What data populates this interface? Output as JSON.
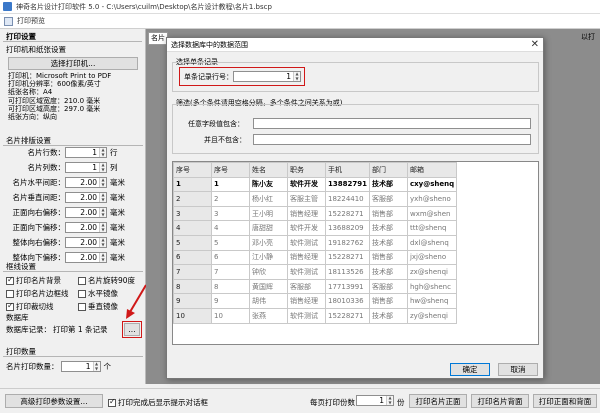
{
  "window": {
    "title": "神奇名片设计打印软件 5.0 - C:\\Users\\cuilm\\Desktop\\名片设计教程\\名片1.bscp"
  },
  "preview_window": {
    "title": "打印预览"
  },
  "left": {
    "print_settings": "打印设置",
    "printer_section": "打印机和纸张设置",
    "choose_printer": "选择打印机...",
    "info": [
      "打印机：Microsoft Print to PDF",
      "打印机分辨率：600像素/英寸",
      "纸张名称：A4",
      "可打印区域宽度：210.0 毫米",
      "可打印区域高度：297.0 毫米",
      "纸张方向：纵向"
    ],
    "layout_section": "名片排版设置",
    "fields": [
      {
        "label": "名片行数：",
        "value": "1",
        "unit": "行"
      },
      {
        "label": "名片列数：",
        "value": "1",
        "unit": "列"
      },
      {
        "label": "名片水平间距：",
        "value": "2.00",
        "unit": "毫米"
      },
      {
        "label": "名片垂直间距：",
        "value": "2.00",
        "unit": "毫米"
      },
      {
        "label": "正面向右偏移：",
        "value": "2.00",
        "unit": "毫米"
      },
      {
        "label": "正面向下偏移：",
        "value": "2.00",
        "unit": "毫米"
      },
      {
        "label": "整体向右偏移：",
        "value": "2.00",
        "unit": "毫米"
      },
      {
        "label": "整体向下偏移：",
        "value": "2.00",
        "unit": "毫米"
      }
    ],
    "frame_section": "框线设置",
    "checks": [
      {
        "label": "打印名片背景",
        "checked": true
      },
      {
        "label": "名片旋转90度",
        "checked": false
      },
      {
        "label": "打印名片边框线",
        "checked": false
      },
      {
        "label": "水平镜像",
        "checked": false
      },
      {
        "label": "打印裁切线",
        "checked": true
      },
      {
        "label": "垂直镜像",
        "checked": false
      }
    ],
    "db_section": "数据库",
    "db_record_label": "数据库记录：",
    "db_record_value": "打印第 1 条记录",
    "db_browse": "...",
    "qty_section": "打印数量",
    "qty_label": "名片打印数量：",
    "qty_value": "1",
    "qty_unit": "个"
  },
  "bottom": {
    "advanced": "高级打印参数设置...",
    "show_tip": "打印完成后显示提示对话框",
    "per_page_label": "每页打印份数：",
    "per_page_value": "1",
    "per_page_unit": "份",
    "print_front": "打印名片正面",
    "print_back": "打印名片背面",
    "print_both": "打印正面和背面"
  },
  "preview": {
    "tab_left": "名片",
    "tab_right": "以打"
  },
  "dialog": {
    "title": "选择数据库中的数据范围",
    "single_group": "选择单条记录",
    "single_label": "单条记录行号：",
    "single_value": "1",
    "filter_group": "筛选(多个条件请用空格分隔，多个条件之间关系为或)",
    "contains_label": "任意字段值包含：",
    "excludes_label": "并且不包含：",
    "ok": "确定",
    "cancel": "取消"
  },
  "table": {
    "headers": [
      "序号",
      "序号",
      "姓名",
      "职务",
      "手机",
      "部门",
      "邮箱"
    ],
    "rows": [
      [
        "1",
        "1",
        "陈小友",
        "软件开发",
        "13882791",
        "技术部",
        "cxy@shenq"
      ],
      [
        "2",
        "2",
        "杨小红",
        "客服主管",
        "18224410",
        "客服部",
        "yxh@sheno"
      ],
      [
        "3",
        "3",
        "王小明",
        "销售经理",
        "15228271",
        "销售部",
        "wxm@shen"
      ],
      [
        "4",
        "4",
        "唐甜甜",
        "软件开发",
        "13688209",
        "技术部",
        "ttt@shenq"
      ],
      [
        "5",
        "5",
        "邓小亮",
        "软件测试",
        "19182762",
        "技术部",
        "dxl@shenq"
      ],
      [
        "6",
        "6",
        "江小静",
        "销售经理",
        "15228271",
        "销售部",
        "jxj@sheno"
      ],
      [
        "7",
        "7",
        "钟欣",
        "软件测试",
        "18113526",
        "技术部",
        "zx@shenqi"
      ],
      [
        "8",
        "8",
        "黄国辉",
        "客服部",
        "17713991",
        "客服部",
        "hgh@shenc"
      ],
      [
        "9",
        "9",
        "胡伟",
        "销售经理",
        "18010336",
        "销售部",
        "hw@shenq"
      ],
      [
        "10",
        "10",
        "张燕",
        "软件测试",
        "15228271",
        "技术部",
        "zy@shenqi"
      ]
    ]
  }
}
